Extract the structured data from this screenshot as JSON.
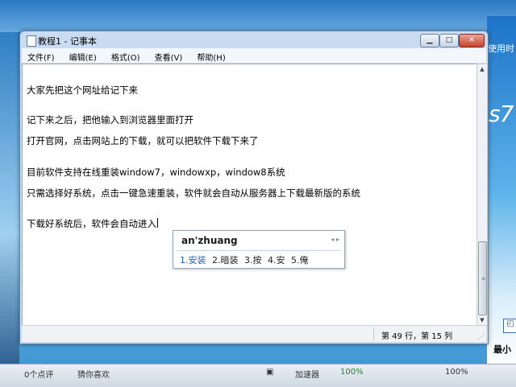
{
  "background": {
    "right_title": "使用时",
    "right_logo": "s7",
    "right_bold": "最小",
    "status_left": "0个点评",
    "status_left2": "猜你喜欢",
    "accelerator": "加速器",
    "zoom1": "100%",
    "zoom2": "100%"
  },
  "window": {
    "title": "教程1 - 记事本",
    "buttons": {
      "minimize": "▁",
      "maximize": "□",
      "close": "✕"
    }
  },
  "menu": [
    "文件(F)",
    "编辑(E)",
    "格式(O)",
    "查看(V)",
    "帮助(H)"
  ],
  "editor": {
    "lines": [
      "大家先把这个网址给记下来",
      "记下来之后，把他输入到浏览器里面打开",
      "打开官网，点击网站上的下载，就可以把软件下载下来了",
      "目前软件支持在线重装window7，windowxp，window8系统",
      "只需选择好系统，点击一键急速重装，软件就会自动从服务器上下载最新版的系统",
      "下载好系统后，软件会自动进入"
    ]
  },
  "status": {
    "position": "第 49 行，第 15 列"
  },
  "ime": {
    "pinyin": "an'zhuang",
    "arrows": "◂ ▸",
    "candidates": [
      "1.安装",
      "2.暗装",
      "3.按",
      "4.安",
      "5.俺"
    ]
  },
  "colors": {
    "accent": "#1f5fb5",
    "desktop": "#2d9be3"
  }
}
